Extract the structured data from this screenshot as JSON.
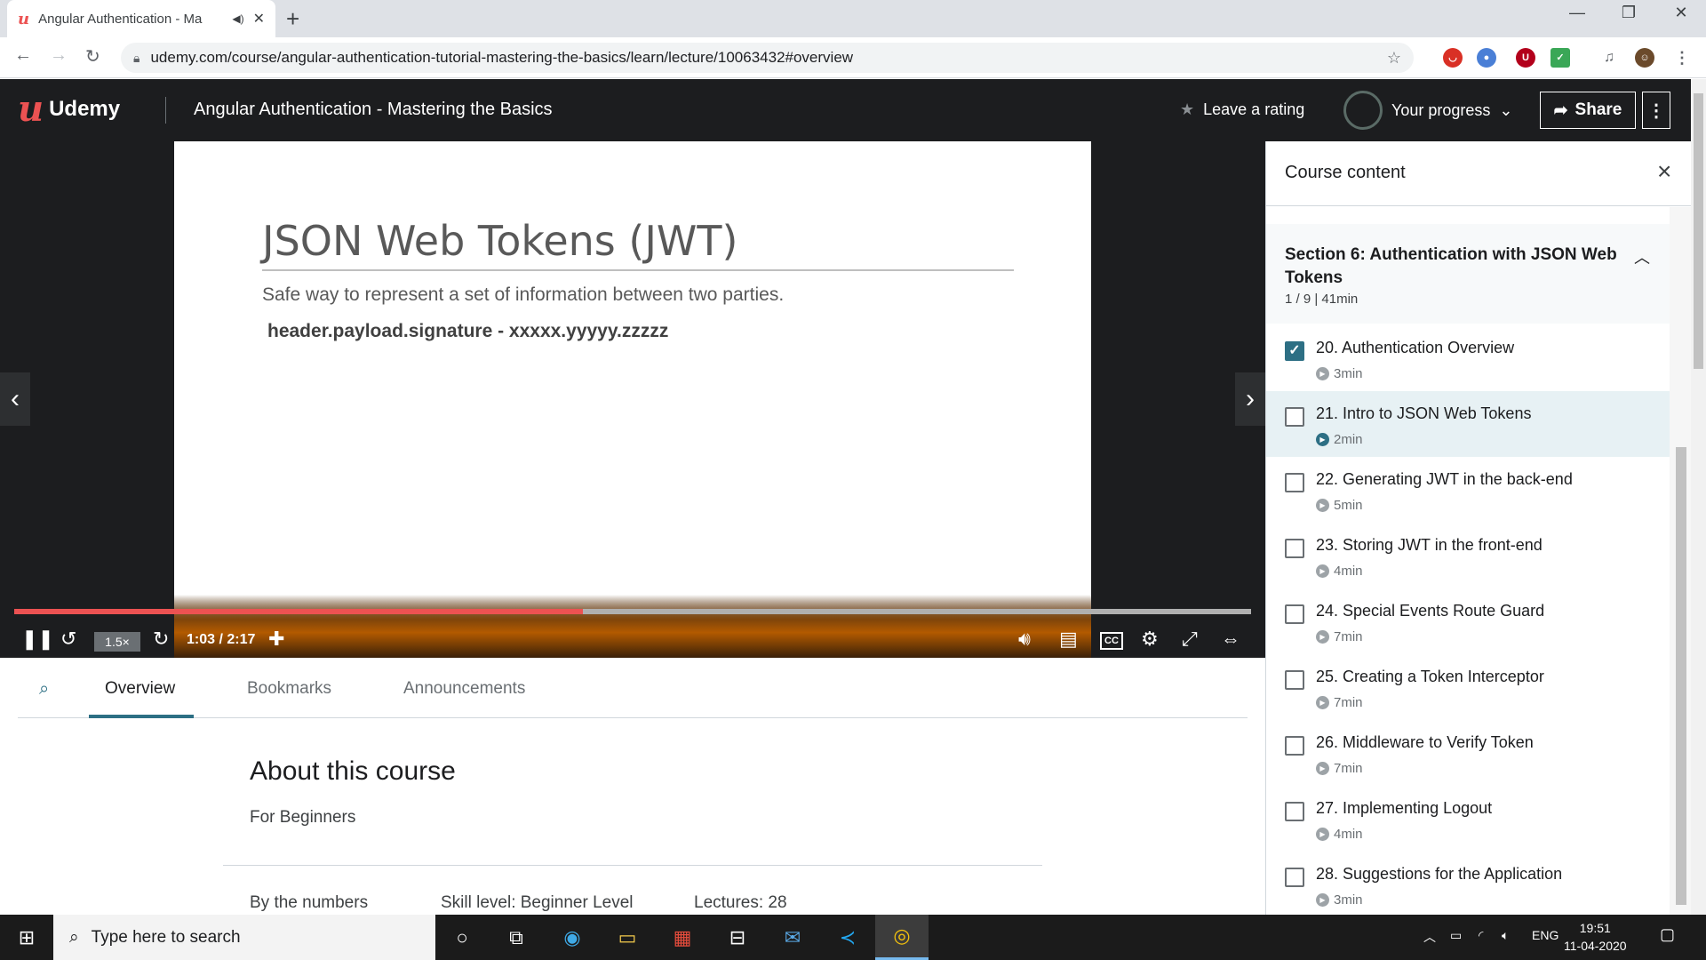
{
  "browser": {
    "tab_title": "Angular Authentication - Ma",
    "tab_close": "✕",
    "new_tab": "+",
    "url": "udemy.com/course/angular-authentication-tutorial-mastering-the-basics/learn/lecture/10063432#overview"
  },
  "header": {
    "logo_text": "Udemy",
    "course_title": "Angular Authentication - Mastering the Basics",
    "leave_rating": "Leave a rating",
    "progress_label": "Your progress",
    "share_label": "Share"
  },
  "slide": {
    "title": "JSON Web Tokens (JWT)",
    "description": "Safe way to represent a set of information between two parties.",
    "code": "header.payload.signature - xxxxx.yyyyy.zzzzz"
  },
  "player": {
    "speed": "1.5×",
    "timecode": "1:03 / 2:17",
    "progress_fraction": 0.46,
    "buffered_fraction": 0.0,
    "cc_label": "CC"
  },
  "tabs": [
    {
      "label": "Overview"
    },
    {
      "label": "Bookmarks"
    },
    {
      "label": "Announcements"
    }
  ],
  "about": {
    "heading": "About this course",
    "subtitle": "For Beginners",
    "by_numbers": "By the numbers",
    "skill_level": "Skill level: Beginner Level",
    "lectures": "Lectures: 28"
  },
  "sidebar": {
    "title": "Course content",
    "section": {
      "title": "Section 6: Authentication with JSON Web Tokens",
      "meta": "1 / 9 | 41min"
    },
    "lectures": [
      {
        "title": "20. Authentication Overview",
        "duration": "3min",
        "checked": true
      },
      {
        "title": "21. Intro to JSON Web Tokens",
        "duration": "2min",
        "checked": false,
        "current": true
      },
      {
        "title": "22. Generating JWT in the back-end",
        "duration": "5min",
        "checked": false
      },
      {
        "title": "23. Storing JWT in the front-end",
        "duration": "4min",
        "checked": false
      },
      {
        "title": "24. Special Events Route Guard",
        "duration": "7min",
        "checked": false
      },
      {
        "title": "25. Creating a Token Interceptor",
        "duration": "7min",
        "checked": false
      },
      {
        "title": "26. Middleware to Verify Token",
        "duration": "7min",
        "checked": false
      },
      {
        "title": "27. Implementing Logout",
        "duration": "4min",
        "checked": false
      },
      {
        "title": "28. Suggestions for the Application",
        "duration": "3min",
        "checked": false
      }
    ]
  },
  "taskbar": {
    "search_placeholder": "Type here to search",
    "language": "ENG",
    "time": "19:51",
    "date": "11-04-2020"
  },
  "colors": {
    "brand": "#ec5252",
    "header_bg": "#1c1d1f",
    "accent": "#2d6f84"
  }
}
